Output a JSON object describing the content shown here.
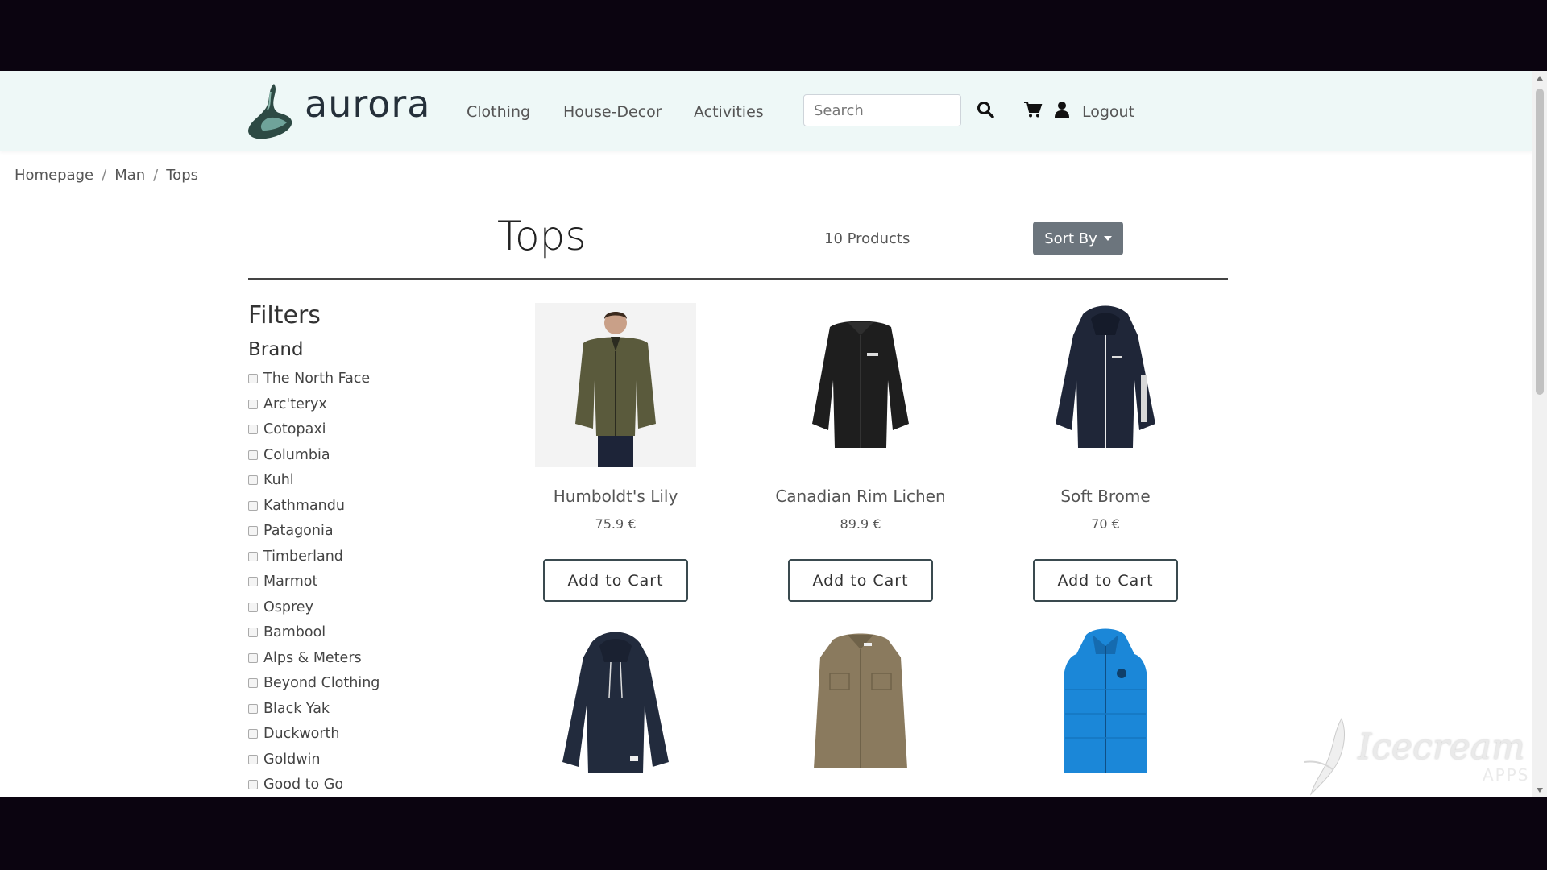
{
  "header": {
    "brand": "aurora",
    "nav": [
      "Clothing",
      "House-Decor",
      "Activities"
    ],
    "search_placeholder": "Search",
    "logout_label": "Logout"
  },
  "breadcrumb": [
    "Homepage",
    "Man",
    "Tops"
  ],
  "page": {
    "title": "Tops",
    "count": "10 Products",
    "sort_label": "Sort By"
  },
  "filters": {
    "title": "Filters",
    "brand_title": "Brand",
    "brands": [
      "The North Face",
      "Arc'teryx",
      "Cotopaxi",
      "Columbia",
      "Kuhl",
      "Kathmandu",
      "Patagonia",
      "Timberland",
      "Marmot",
      "Osprey",
      "Bambool",
      "Alps & Meters",
      "Beyond Clothing",
      "Black Yak",
      "Duckworth",
      "Goldwin",
      "Good to Go"
    ]
  },
  "products": [
    {
      "name": "Humboldt's Lily",
      "price": "75.9 €",
      "button": "Add to Cart"
    },
    {
      "name": "Canadian Rim Lichen",
      "price": "89.9 €",
      "button": "Add to Cart"
    },
    {
      "name": "Soft Brome",
      "price": "70 €",
      "button": "Add to Cart"
    }
  ],
  "watermark": {
    "text": "Icecream",
    "sub": "APPS"
  },
  "colors": {
    "header_bg": "#eef8f7",
    "sort_button": "#6c757d",
    "jacket_olive": "#5a5a3c",
    "jacket_black": "#1e1e1e",
    "jacket_navy": "#1f2638",
    "hoodie_navy": "#222b3d",
    "shirt_khaki": "#8a7a5e",
    "vest_blue": "#1b87d8"
  }
}
